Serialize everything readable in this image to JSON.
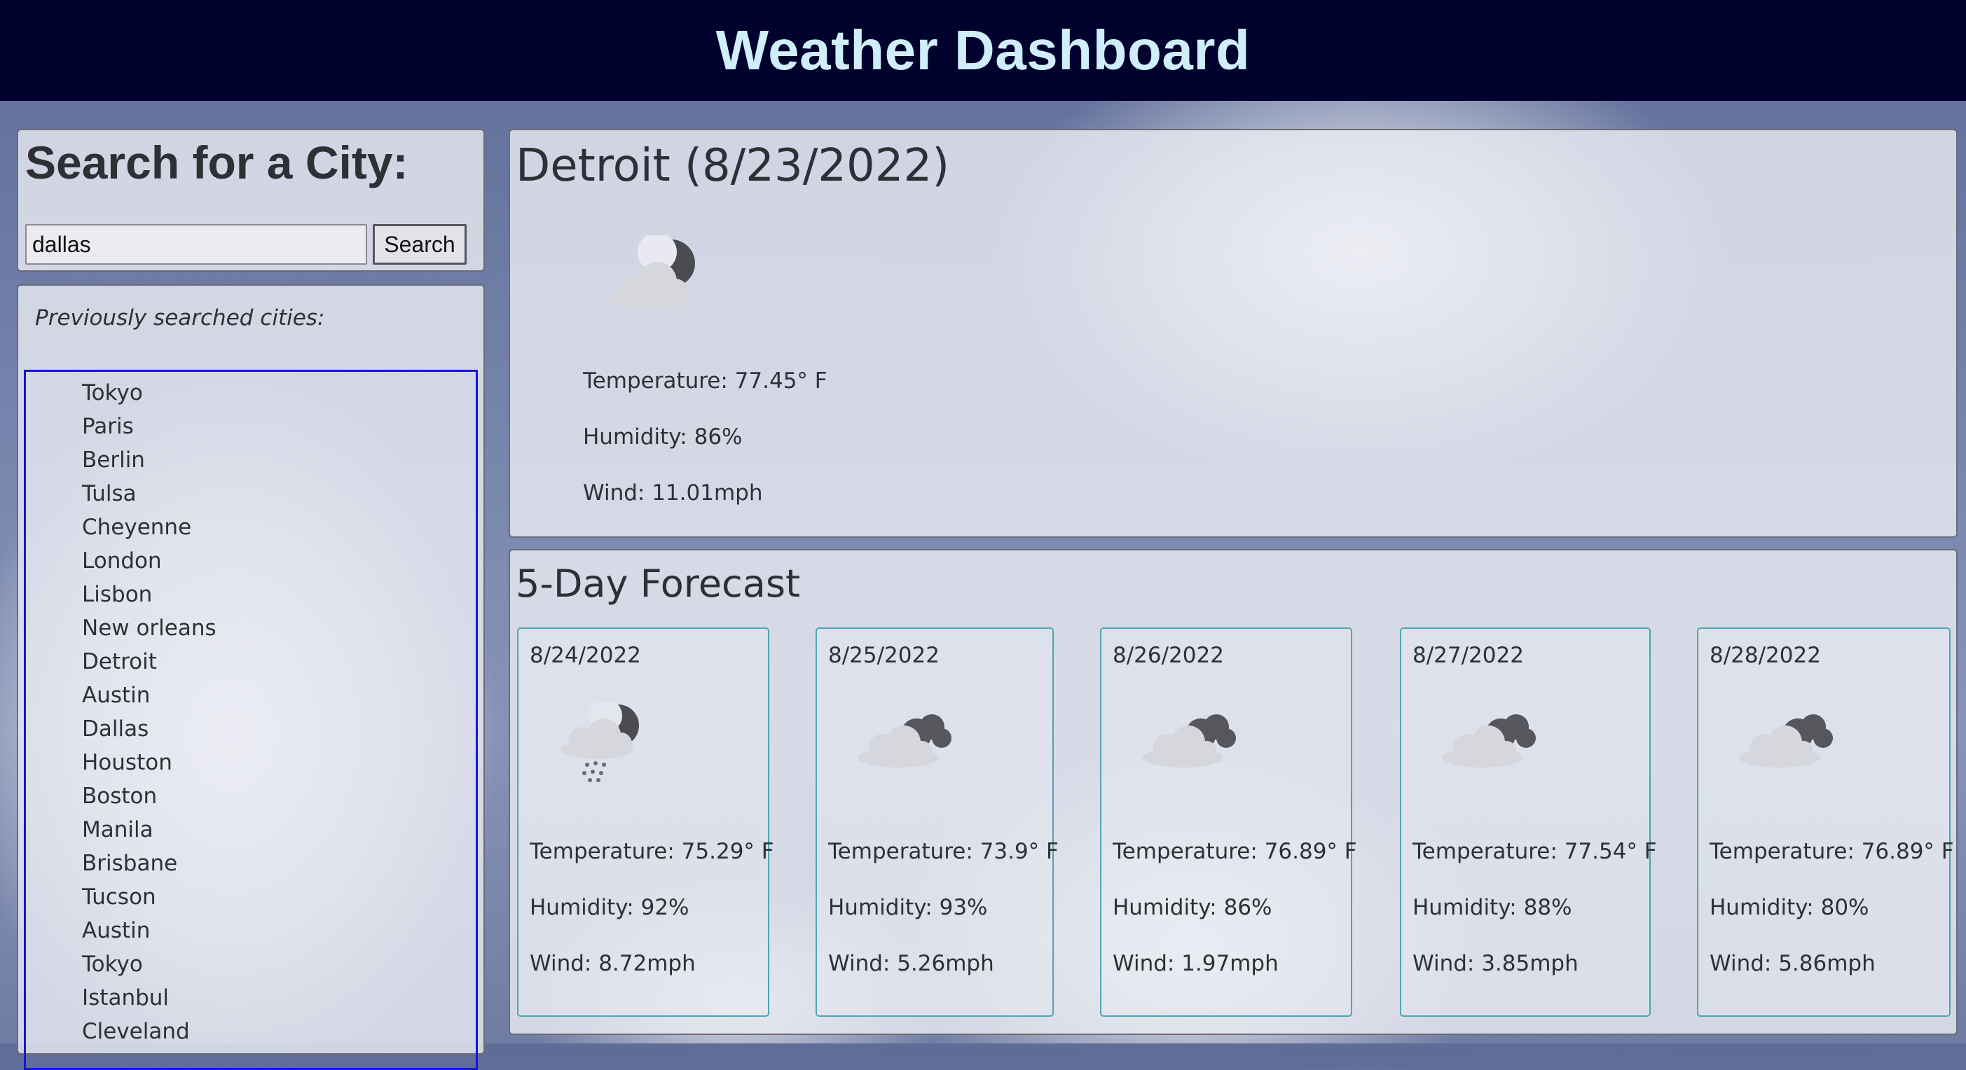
{
  "header": {
    "title": "Weather Dashboard"
  },
  "search": {
    "heading": "Search for a City:",
    "input_value": "dallas",
    "button_label": "Search"
  },
  "history": {
    "heading": "Previously searched cities:",
    "cities": [
      "Tokyo",
      "Paris",
      "Berlin",
      "Tulsa",
      "Cheyenne",
      "London",
      "Lisbon",
      "New orleans",
      "Detroit",
      "Austin",
      "Dallas",
      "Houston",
      "Boston",
      "Manila",
      "Brisbane",
      "Tucson",
      "Austin",
      "Tokyo",
      "Istanbul",
      "Cleveland"
    ]
  },
  "current": {
    "title": "Detroit (8/23/2022)",
    "icon": "cloud-moon-icon",
    "temperature": "Temperature: 77.45° F",
    "humidity": "Humidity: 86%",
    "wind": "Wind: 11.01mph"
  },
  "forecast": {
    "heading": "5-Day Forecast",
    "days": [
      {
        "date": "8/24/2022",
        "icon": "cloud-moon-rain-icon",
        "temperature": "Temperature: 75.29° F",
        "humidity": "Humidity: 92%",
        "wind": "Wind: 8.72mph"
      },
      {
        "date": "8/25/2022",
        "icon": "broken-clouds-icon",
        "temperature": "Temperature: 73.9° F",
        "humidity": "Humidity: 93%",
        "wind": "Wind: 5.26mph"
      },
      {
        "date": "8/26/2022",
        "icon": "broken-clouds-icon",
        "temperature": "Temperature: 76.89° F",
        "humidity": "Humidity: 86%",
        "wind": "Wind: 1.97mph"
      },
      {
        "date": "8/27/2022",
        "icon": "broken-clouds-icon",
        "temperature": "Temperature: 77.54° F",
        "humidity": "Humidity: 88%",
        "wind": "Wind: 3.85mph"
      },
      {
        "date": "8/28/2022",
        "icon": "broken-clouds-icon",
        "temperature": "Temperature: 76.89° F",
        "humidity": "Humidity: 80%",
        "wind": "Wind: 5.86mph"
      }
    ]
  }
}
